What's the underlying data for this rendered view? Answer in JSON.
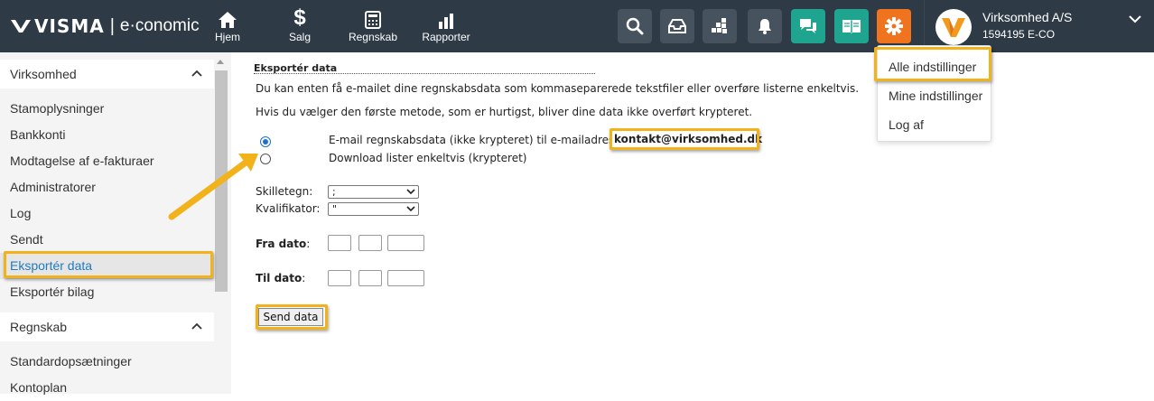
{
  "brand": {
    "mark": "VISMA",
    "separator": "|",
    "product": "e·conomic"
  },
  "nav": [
    {
      "label": "Hjem",
      "icon": "home-icon"
    },
    {
      "label": "Salg",
      "icon": "dollar-icon"
    },
    {
      "label": "Regnskab",
      "icon": "calculator-icon"
    },
    {
      "label": "Rapporter",
      "icon": "bar-chart-icon"
    }
  ],
  "toolbar_icons": [
    "search-icon",
    "inbox-icon",
    "apps-icon",
    "bell-icon",
    "chat-icon",
    "book-icon",
    "gear-icon"
  ],
  "account": {
    "name": "Virksomhed A/S",
    "id": "1594195 E-CO"
  },
  "sidebar": {
    "group1": {
      "title": "Virksomhed",
      "items": [
        "Stamoplysninger",
        "Bankkonti",
        "Modtagelse af e-fakturaer",
        "Administratorer",
        "Log",
        "Sendt",
        "Eksportér data",
        "Eksportér bilag"
      ]
    },
    "group2": {
      "title": "Regnskab",
      "items": [
        "Standardopsætninger",
        "Kontoplan"
      ]
    },
    "active_item": "Eksportér data"
  },
  "main": {
    "title": "Eksportér data",
    "intro1": "Du kan enten få e-mailet dine regnskabsdata som kommaseparerede tekstfiler eller overføre listerne enkeltvis.",
    "intro2": "Hvis du vælger den første metode, som er hurtigst, bliver dine data ikke overført krypteret.",
    "option_email": "E-mail regnskabsdata (ikke krypteret) til e-mailadresse",
    "email_value": "kontakt@virksomhed.dk",
    "option_download": "Download lister enkeltvis (krypteret)",
    "separator_label": "Skilletegn:",
    "separator_value": ";",
    "qualifier_label": "Kvalifikator:",
    "qualifier_value": "\"",
    "from_label": "Fra dato",
    "from_colon": ":",
    "to_label": "Til dato",
    "to_colon": ":",
    "send_button": "Send data"
  },
  "dropdown": {
    "items": [
      "Alle indstillinger",
      "Mine indstillinger",
      "Log af"
    ]
  },
  "colors": {
    "topbar": "#2e3a45",
    "accent_teal": "#1fa58f",
    "accent_orange": "#f0731d",
    "highlight": "#f2b21b",
    "active_link": "#1f7bc2"
  }
}
